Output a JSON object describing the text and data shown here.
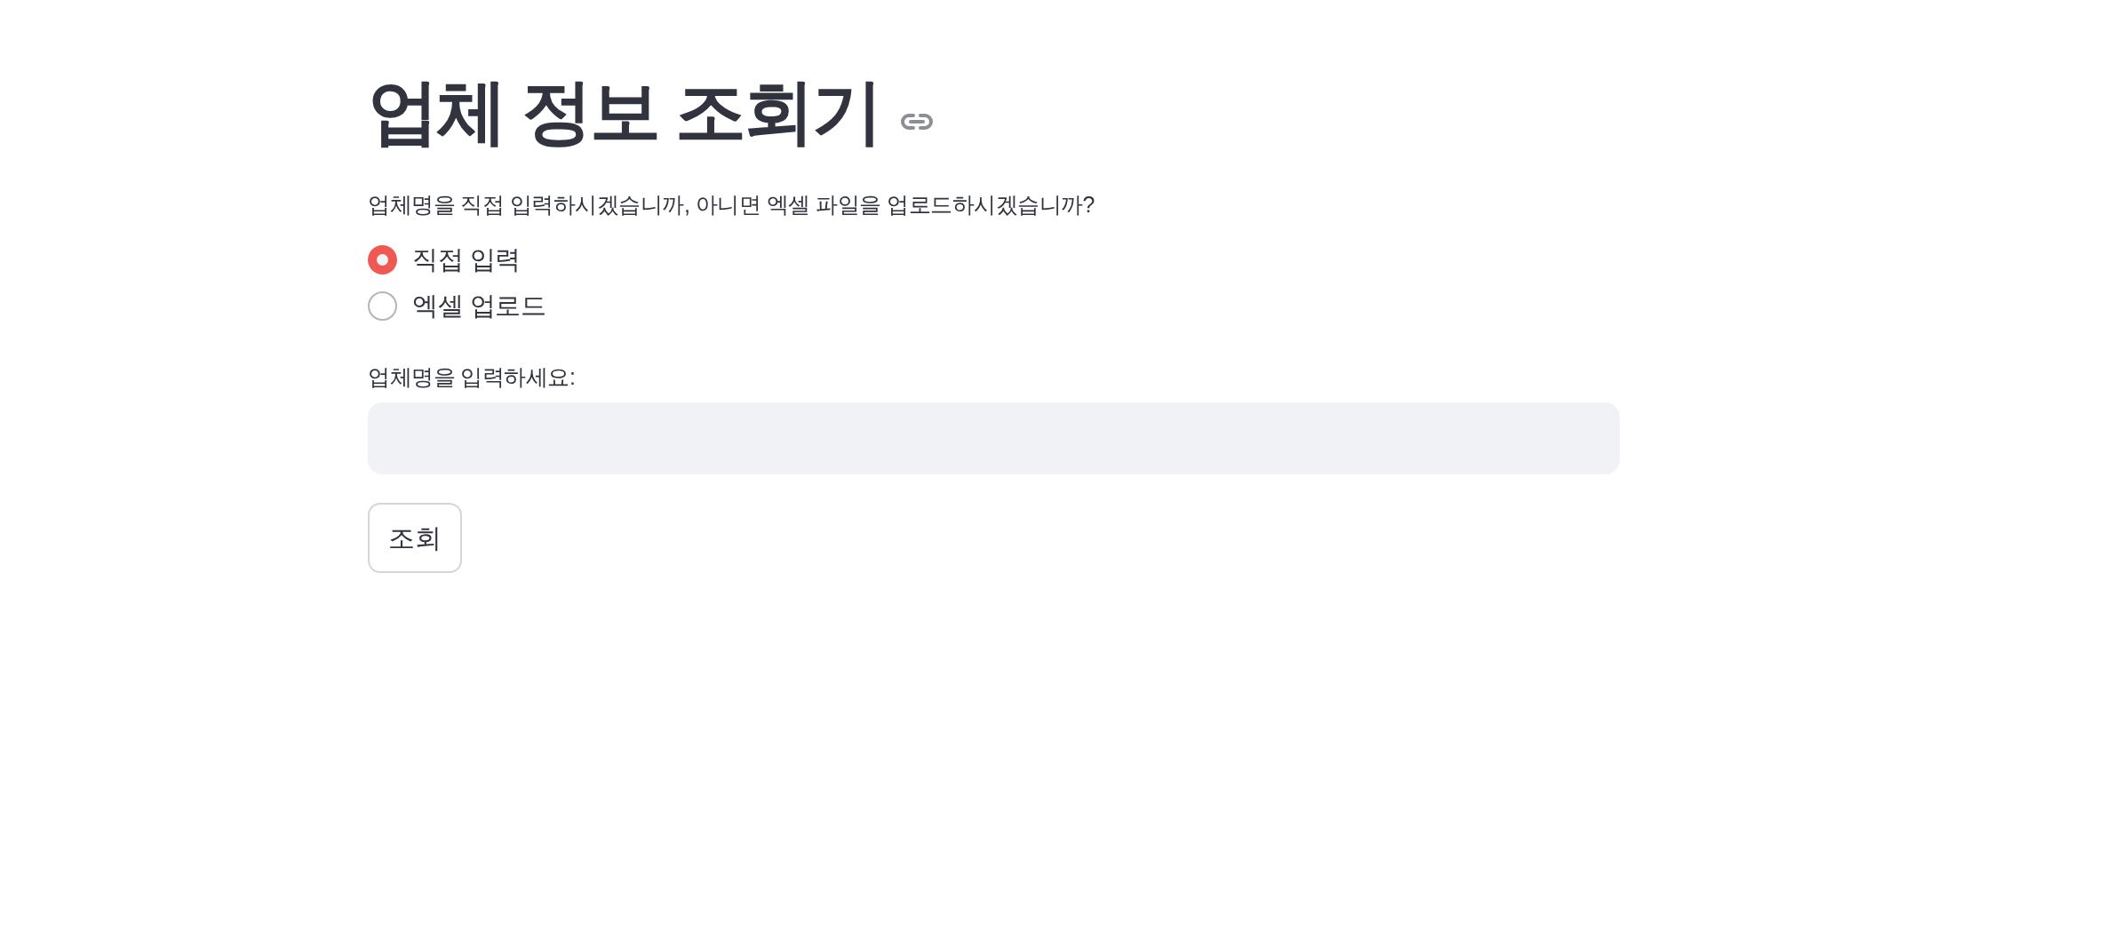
{
  "title": {
    "text": "업체 정보 조회기"
  },
  "question": "업체명을 직접 입력하시겠습니까, 아니면 엑셀 파일을 업로드하시겠습니까?",
  "mode_options": [
    {
      "label": "직접 입력",
      "selected": true
    },
    {
      "label": "엑셀 업로드",
      "selected": false
    }
  ],
  "company_field": {
    "label": "업체명을 입력하세요:"
  },
  "buttons": [
    {
      "label": "조회"
    }
  ]
}
